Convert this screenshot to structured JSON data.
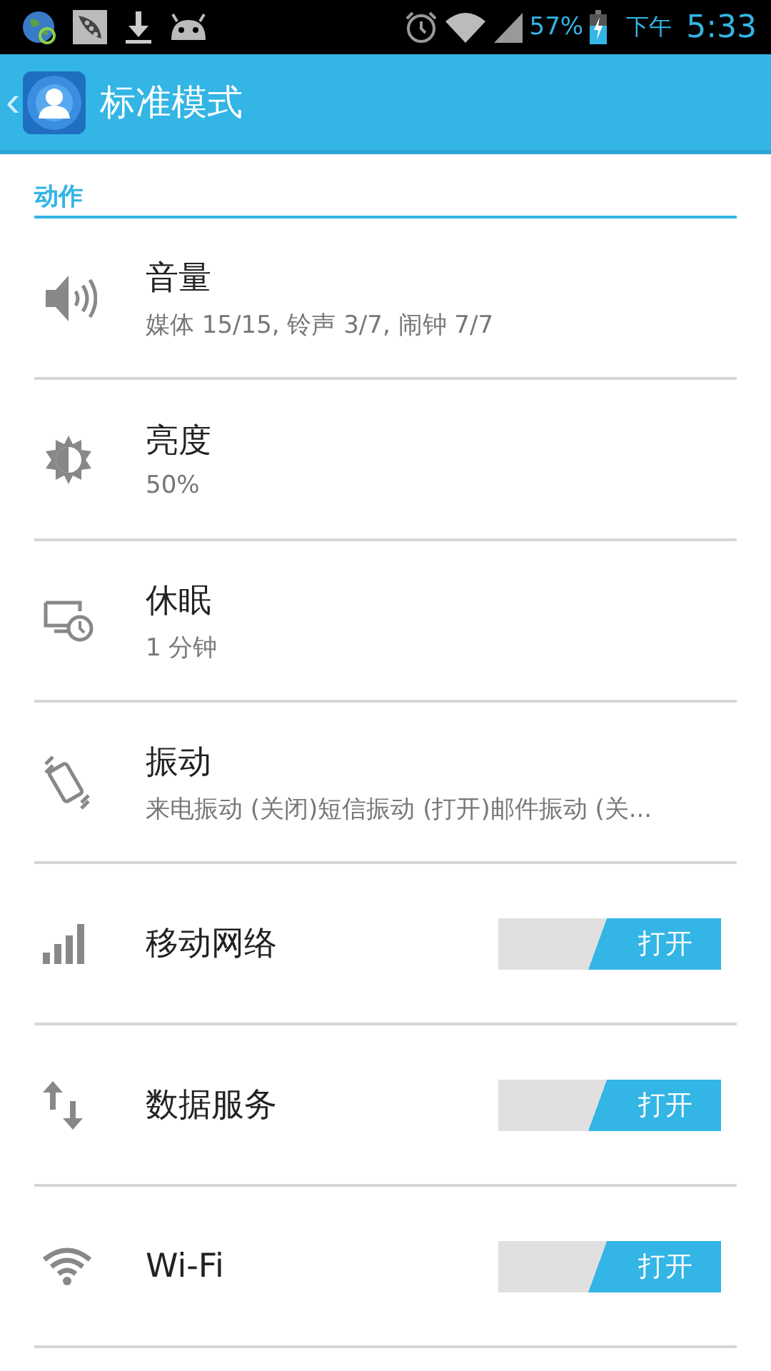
{
  "status_bar": {
    "battery": "57%",
    "period": "下午",
    "time": "5:33"
  },
  "title_bar": {
    "back": "‹",
    "title": "标准模式"
  },
  "section": {
    "title": "动作"
  },
  "rows": [
    {
      "kind": "summary",
      "title": "音量",
      "summary": "媒体 15/15, 铃声 3/7, 闹钟 7/7"
    },
    {
      "kind": "summary",
      "title": "亮度",
      "summary": "50%"
    },
    {
      "kind": "summary",
      "title": "休眠",
      "summary": "1 分钟"
    },
    {
      "kind": "summary",
      "title": "振动",
      "summary": "来电振动 (关闭)短信振动 (打开)邮件振动 (关..."
    },
    {
      "kind": "toggle",
      "title": "移动网络",
      "on": true,
      "state_label": "打开"
    },
    {
      "kind": "toggle",
      "title": "数据服务",
      "on": true,
      "state_label": "打开"
    },
    {
      "kind": "toggle",
      "title": "Wi-Fi",
      "on": true,
      "state_label": "打开"
    }
  ]
}
